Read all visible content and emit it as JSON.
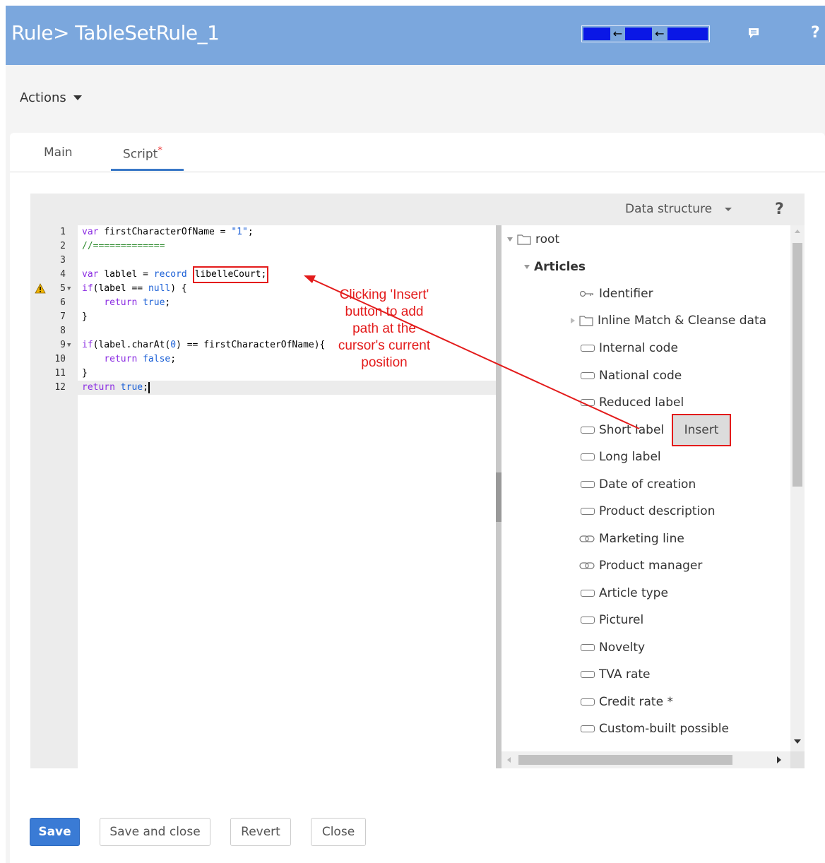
{
  "header": {
    "title": "Rule> TableSetRule_1",
    "arrow_glyph": "←",
    "help": "?"
  },
  "actions": {
    "label": "Actions"
  },
  "tabs": [
    {
      "label": "Main"
    },
    {
      "label": "Script",
      "modified_mark": "*"
    }
  ],
  "data_structure": {
    "label": "Data structure",
    "help": "?"
  },
  "code": {
    "lines": [
      {
        "n": "1"
      },
      {
        "n": "2"
      },
      {
        "n": "3"
      },
      {
        "n": "4"
      },
      {
        "n": "5"
      },
      {
        "n": "6"
      },
      {
        "n": "7"
      },
      {
        "n": "8"
      },
      {
        "n": "9"
      },
      {
        "n": "10"
      },
      {
        "n": "11"
      },
      {
        "n": "12"
      }
    ],
    "tokens": {
      "l1_kw": "var",
      "l1_rest": " firstCharacterOfName = ",
      "l1_str": "\"1\"",
      "l1_end": ";",
      "l2": "//=============",
      "l4_kw": "var",
      "l4_mid": " lablel = ",
      "l4_kw2": "record",
      "l4_sp": " ",
      "l4_hl": "libelleCourt;",
      "l5_kw": "if",
      "l5_mid": "(label == ",
      "l5_kw2": "null",
      "l5_end": ") {",
      "l6_pad": "    ",
      "l6_kw": "return",
      "l6_sp": " ",
      "l6_kw2": "true",
      "l6_end": ";",
      "l7": "}",
      "l9_kw": "if",
      "l9_mid": "(label.charAt(",
      "l9_num": "0",
      "l9_end": ") == firstCharacterOfName){",
      "l10_pad": "    ",
      "l10_kw": "return",
      "l10_sp": " ",
      "l10_kw2": "false",
      "l10_end": ";",
      "l11": "}",
      "l12_kw": "return",
      "l12_sp": " ",
      "l12_kw2": "true",
      "l12_end": ";"
    }
  },
  "tree": {
    "root": "root",
    "articles": "Articles",
    "items": [
      "Identifier",
      "Inline Match & Cleanse data",
      "Internal code",
      "National code",
      "Reduced label",
      "Short label",
      "Long label",
      "Date of creation",
      "Product description",
      "Marketing line",
      "Product manager",
      "Article type",
      "Picturel",
      "Novelty",
      "TVA rate",
      "Credit rate *",
      "Custom-built possible"
    ],
    "insert_button": "Insert"
  },
  "annotation": {
    "text_lines": [
      "Clicking 'Insert'",
      "button to add",
      "path at the",
      "cursor's current",
      "position"
    ],
    "color": "#e31b1b"
  },
  "buttons": {
    "save": "Save",
    "save_and_close": "Save and close",
    "revert": "Revert",
    "close": "Close"
  },
  "colors": {
    "header_bg": "#7ba7dd",
    "accent": "#3a7bd5",
    "highlight_red": "#e31b1b"
  }
}
